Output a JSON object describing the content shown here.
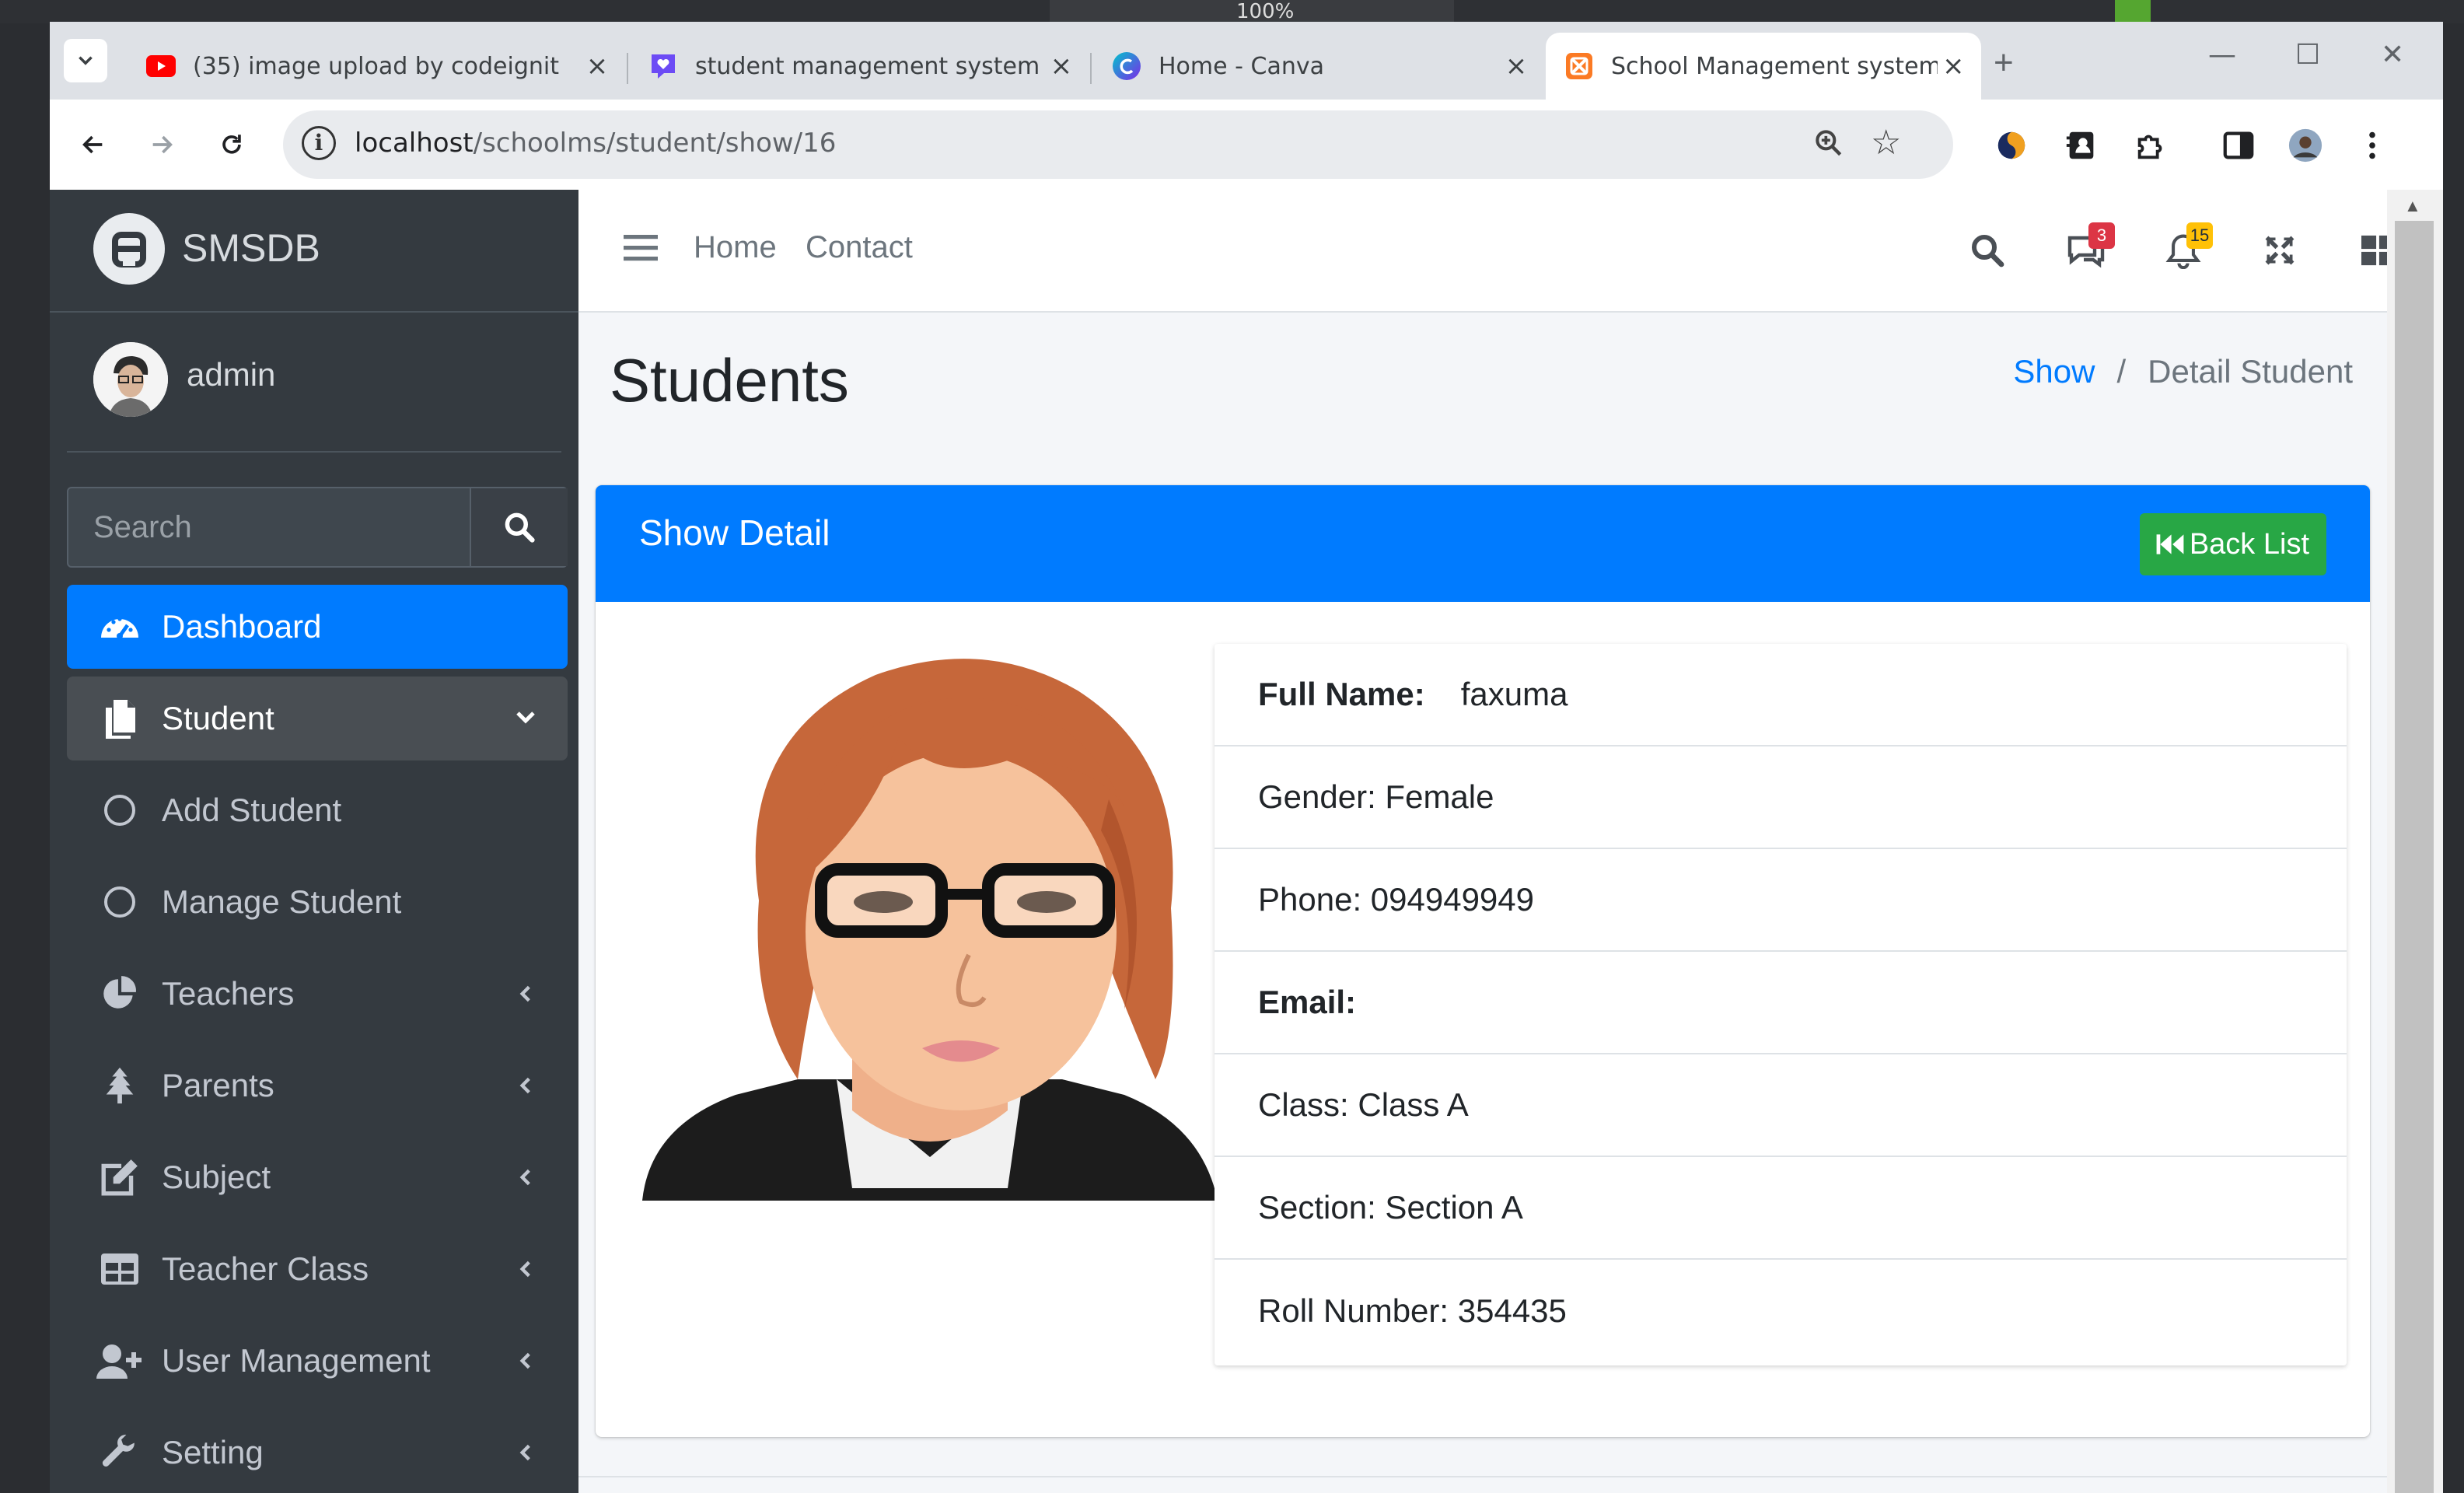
{
  "browser": {
    "tabs": [
      {
        "title": "(35) image upload by codeignit",
        "favicon": "youtube-icon",
        "active": false
      },
      {
        "title": "student management system p",
        "favicon": "heart-chat-icon",
        "active": false
      },
      {
        "title": "Home - Canva",
        "favicon": "canva-icon",
        "active": false
      },
      {
        "title": "School Management system",
        "favicon": "xampp-icon",
        "active": true
      }
    ],
    "url_host": "localhost",
    "url_path": "/schoolms/student/show/16",
    "zoom_level": "100%"
  },
  "sidebar": {
    "brand": "SMSDB",
    "user": "admin",
    "search_placeholder": "Search",
    "items": [
      {
        "label": "Dashboard",
        "icon": "dashboard-icon",
        "state": "active",
        "arrow": ""
      },
      {
        "label": "Student",
        "icon": "copy-icon",
        "state": "open",
        "arrow": "chevron-down"
      },
      {
        "label": "Add Student",
        "icon": "circle-icon",
        "state": "sub",
        "arrow": ""
      },
      {
        "label": "Manage Student",
        "icon": "circle-icon",
        "state": "sub",
        "arrow": ""
      },
      {
        "label": "Teachers",
        "icon": "pie-chart-icon",
        "state": "",
        "arrow": "chevron-left"
      },
      {
        "label": "Parents",
        "icon": "tree-icon",
        "state": "",
        "arrow": "chevron-left"
      },
      {
        "label": "Subject",
        "icon": "edit-icon",
        "state": "",
        "arrow": "chevron-left"
      },
      {
        "label": "Teacher Class",
        "icon": "table-icon",
        "state": "",
        "arrow": "chevron-left"
      },
      {
        "label": "User Management",
        "icon": "user-plus-icon",
        "state": "",
        "arrow": "chevron-left"
      },
      {
        "label": "Setting",
        "icon": "wrench-icon",
        "state": "",
        "arrow": "chevron-left"
      }
    ]
  },
  "topnav": {
    "links": [
      "Home",
      "Contact"
    ],
    "messages_badge": "3",
    "notifications_badge": "15"
  },
  "page": {
    "title": "Students",
    "breadcrumb_link": "Show",
    "breadcrumb_current": "Detail Student"
  },
  "card": {
    "title": "Show Detail",
    "back_button": "Back List"
  },
  "student": {
    "full_name_label": "Full Name:",
    "full_name": "faxuma",
    "gender": "Gender: Female",
    "phone": "Phone: 094949949",
    "email_label": "Email:",
    "class": "Class: Class A",
    "section": "Section: Section A",
    "roll": "Roll Number: 354435"
  },
  "colors": {
    "primary": "#007bff",
    "success": "#28a745",
    "sidebar_bg": "#343a40",
    "badge_red": "#dc3545",
    "badge_yellow": "#ffc107"
  }
}
